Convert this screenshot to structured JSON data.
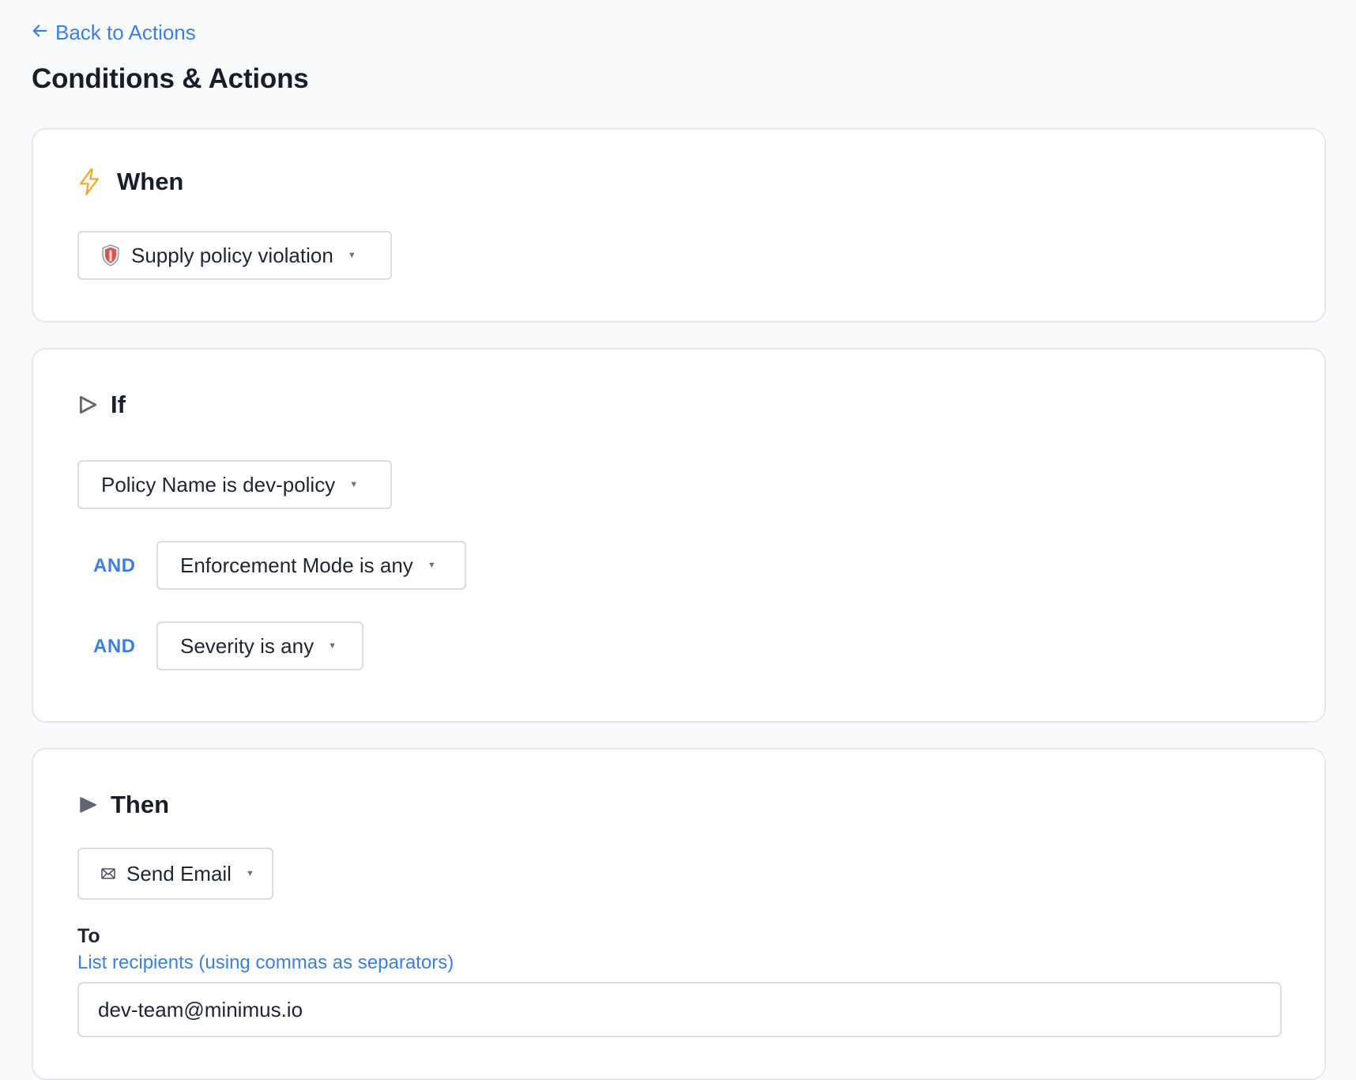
{
  "nav": {
    "back_label": "Back to Actions"
  },
  "page": {
    "title": "Conditions & Actions"
  },
  "when": {
    "heading": "When",
    "trigger_value": "Supply policy violation"
  },
  "if": {
    "heading": "If",
    "conditions": [
      {
        "connector": "",
        "value": "Policy Name is dev-policy"
      },
      {
        "connector": "AND",
        "value": "Enforcement Mode is any"
      },
      {
        "connector": "AND",
        "value": "Severity is any"
      }
    ]
  },
  "then": {
    "heading": "Then",
    "action_value": "Send Email",
    "to_label": "To",
    "to_hint": "List recipients (using commas as separators)",
    "to_value": "dev-team@minimus.io"
  },
  "icons": {
    "back": "arrow-left-icon",
    "when": "lightning-icon",
    "trigger": "shield-icon",
    "if": "play-outline-icon",
    "then": "play-filled-icon",
    "action": "envelope-icon",
    "caret": "caret-down-icon"
  },
  "colors": {
    "accent": "#3a7fe8",
    "lightning": "#f5a623",
    "shield_red": "#d9534f",
    "icon_gray": "#5f6675"
  }
}
